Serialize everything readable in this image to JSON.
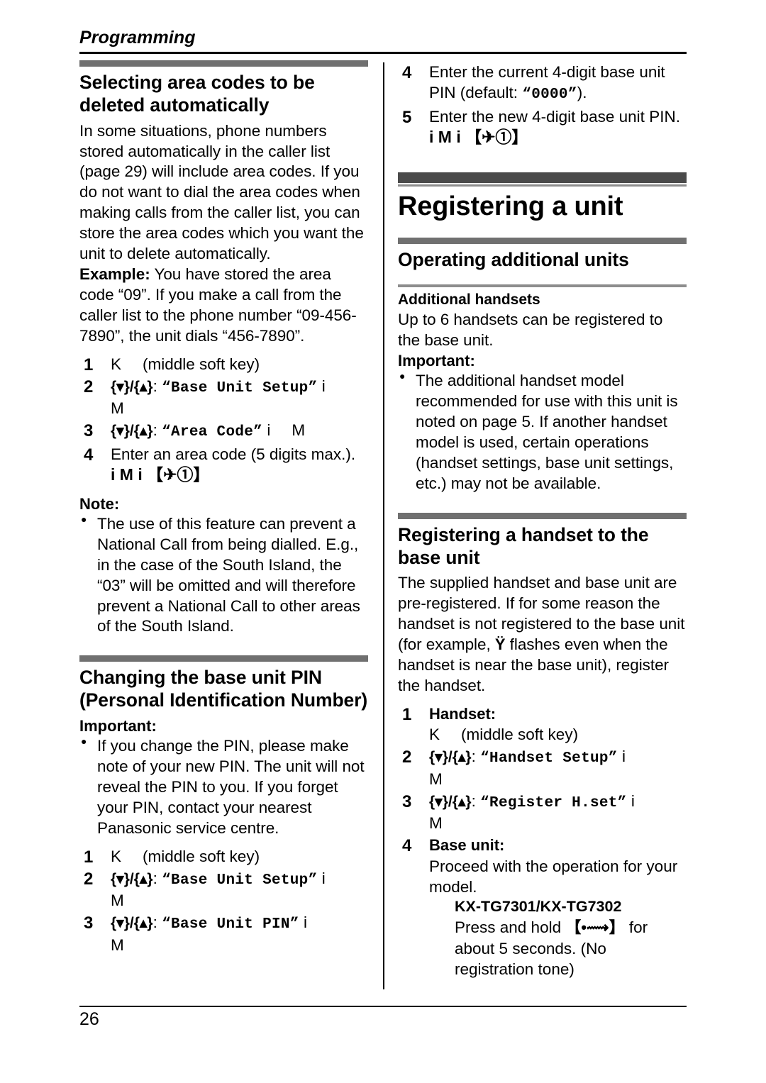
{
  "running_head": {
    "title": "Programming"
  },
  "footer": {
    "page_number": "26"
  },
  "glyphs": {
    "soft_key": "K",
    "select_key": "M",
    "arrow_next": "i",
    "nav_down_up": "{▾}/{▴}",
    "off_key": "【✈①】",
    "page_key": "【•⟿】",
    "antenna": "Ϋ"
  },
  "left_column": {
    "section1": {
      "heading": "Selecting area codes to be deleted automatically",
      "paragraphs": [
        "In some situations, phone numbers stored automatically in the caller list (page 29) will include area codes. If you do not want to dial the area codes when making calls from the caller list, you can store the area codes which you want the unit to delete automatically."
      ],
      "example_label": "Example:",
      "example_text": " You have stored the area code “09”. If you make a call from the caller list to the phone number “09-456-7890”, the unit dials “456-7890”.",
      "steps": [
        {
          "num": "1",
          "key": "K",
          "text": "(middle soft key)"
        },
        {
          "num": "2",
          "nav": "{▾}/{▴}",
          "colon": ":",
          "menu": "“Base Unit Setup”",
          "arrow": "i",
          "select": "M"
        },
        {
          "num": "3",
          "nav": "{▾}/{▴}",
          "colon": ":",
          "menu": "“Area Code”",
          "arrow": "i",
          "select": "M"
        },
        {
          "num": "4",
          "text": "Enter an area code (5 digits max.).",
          "seq": "i   M   i   【✈①】"
        }
      ],
      "note_label": "Note:",
      "note_bullets": [
        "The use of this feature can prevent a National Call from being dialled. E.g., in the case of the South Island, the “03” will be omitted and will therefore prevent a National Call to other areas of the South Island."
      ]
    },
    "section2": {
      "heading": "Changing the base unit PIN (Personal Identification Number)",
      "important_label": "Important:",
      "important_bullets": [
        "If you change the PIN, please make note of your new PIN. The unit will not reveal the PIN to you. If you forget your PIN, contact your nearest Panasonic service centre."
      ],
      "steps": [
        {
          "num": "1",
          "key": "K",
          "text": "(middle soft key)"
        },
        {
          "num": "2",
          "nav": "{▾}/{▴}",
          "colon": ":",
          "menu": "“Base Unit Setup”",
          "arrow": "i",
          "select": "M"
        },
        {
          "num": "3",
          "nav": "{▾}/{▴}",
          "colon": ":",
          "menu": "“Base Unit PIN”",
          "arrow": "i",
          "select": "M"
        }
      ]
    }
  },
  "right_column": {
    "continued_steps": [
      {
        "num": "4",
        "text": "Enter the current 4-digit base unit PIN (default: ",
        "mono_value": "“0000”",
        "text_after": ")."
      },
      {
        "num": "5",
        "text": "Enter the new 4-digit base unit PIN.",
        "seq": "i   M   i   【✈①】"
      }
    ],
    "chapter": {
      "title": "Registering a unit"
    },
    "section1": {
      "heading": "Operating additional units",
      "subheading": "Additional handsets",
      "paragraph": "Up to 6 handsets can be registered to the base unit.",
      "important_label": "Important:",
      "important_bullets": [
        "The additional handset model recommended for use with this unit is noted on page 5. If another handset model is used, certain operations (handset settings, base unit settings, etc.) may not be available."
      ]
    },
    "section2": {
      "heading": "Registering a handset to the base unit",
      "paragraph_pre": "The supplied handset and base unit are pre-registered. If for some reason the handset is not registered to the base unit (for example, ",
      "paragraph_post": " flashes even when the handset is near the base unit), register the handset.",
      "steps": [
        {
          "num": "1",
          "label": "Handset:",
          "key": "K",
          "text": "(middle soft key)"
        },
        {
          "num": "2",
          "nav": "{▾}/{▴}",
          "colon": ":",
          "menu": "“Handset Setup”",
          "arrow": "i",
          "select": "M"
        },
        {
          "num": "3",
          "nav": "{▾}/{▴}",
          "colon": ":",
          "menu": "“Register H.set”",
          "arrow": "i",
          "select": "M"
        },
        {
          "num": "4",
          "label": "Base unit:",
          "text": "Proceed with the operation for your model."
        }
      ],
      "model": {
        "name": "KX-TG7301/KX-TG7302",
        "text_pre": "Press and hold ",
        "key": "【•⟿】",
        "text_post": " for about 5 seconds. (No registration tone)"
      }
    }
  },
  "colors": {
    "chapter_bar": "#4a4a4a",
    "section_bar": "#707070",
    "subsection_bar": "#8d8d8d",
    "rule": "#000000"
  }
}
